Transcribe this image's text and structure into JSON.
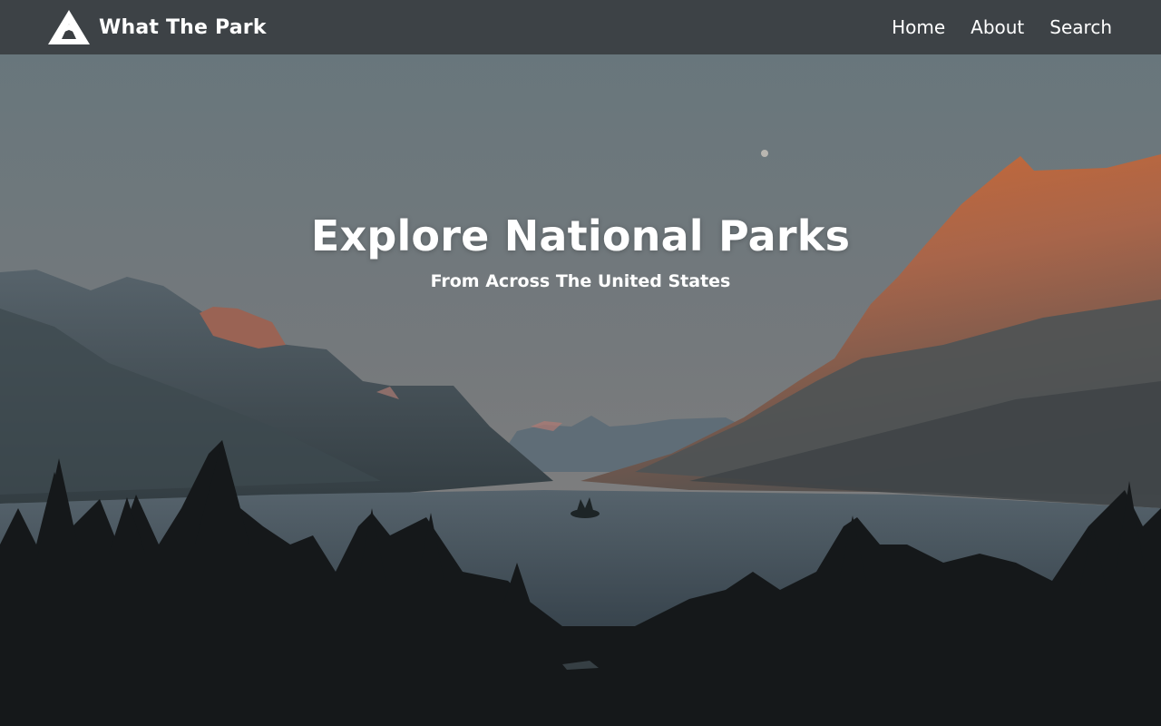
{
  "nav": {
    "brand_name": "What The Park",
    "brand_icon": "mountain-icon",
    "links": [
      {
        "label": "Home"
      },
      {
        "label": "About"
      },
      {
        "label": "Search"
      }
    ]
  },
  "hero": {
    "title": "Explore National Parks",
    "subtitle": "From Across The United States",
    "background_image": "mountain lake landscape photo"
  },
  "colors": {
    "navbar": "#3a3e42",
    "text": "#ffffff",
    "sky": "#6b7c80",
    "sunlit_cliff": "#c46a3a",
    "lake": "#3d4a55",
    "forest": "#15181a"
  }
}
